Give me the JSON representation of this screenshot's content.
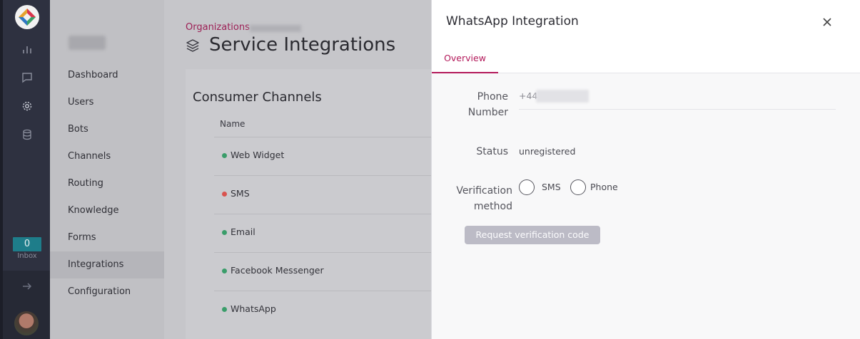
{
  "rail": {
    "icons": [
      "app-logo-icon",
      "analytics-icon",
      "chat-icon",
      "gear-icon",
      "database-icon",
      "arrow-right-icon"
    ],
    "inbox_count": "0",
    "inbox_label": "Inbox"
  },
  "sidebar": {
    "items": [
      {
        "label": "Dashboard"
      },
      {
        "label": "Users"
      },
      {
        "label": "Bots"
      },
      {
        "label": "Channels"
      },
      {
        "label": "Routing"
      },
      {
        "label": "Knowledge"
      },
      {
        "label": "Forms"
      },
      {
        "label": "Integrations",
        "active": true
      },
      {
        "label": "Configuration"
      }
    ]
  },
  "main": {
    "breadcrumb": "Organizations",
    "title": "Service Integrations",
    "card_title": "Consumer Channels",
    "column_name": "Name",
    "rows": [
      {
        "name": "Web Widget",
        "status_color": "#3a9d6a"
      },
      {
        "name": "SMS",
        "status_color": "#d9534f"
      },
      {
        "name": "Email",
        "status_color": "#3a9d6a"
      },
      {
        "name": "Facebook Messenger",
        "status_color": "#3a9d6a"
      },
      {
        "name": "WhatsApp",
        "status_color": "#3a9d6a"
      }
    ]
  },
  "drawer": {
    "title": "WhatsApp Integration",
    "tab_overview": "Overview",
    "phone_label": "Phone Number",
    "phone_prefix": "+44",
    "status_label": "Status",
    "status_value": "unregistered",
    "verification_label": "Verification method",
    "option_sms": "SMS",
    "option_phone": "Phone",
    "request_button": "Request verification code"
  },
  "colors": {
    "accent": "#b3195a",
    "rail_bg": "#2e3140",
    "inbox_badge": "#1e7d8a"
  }
}
